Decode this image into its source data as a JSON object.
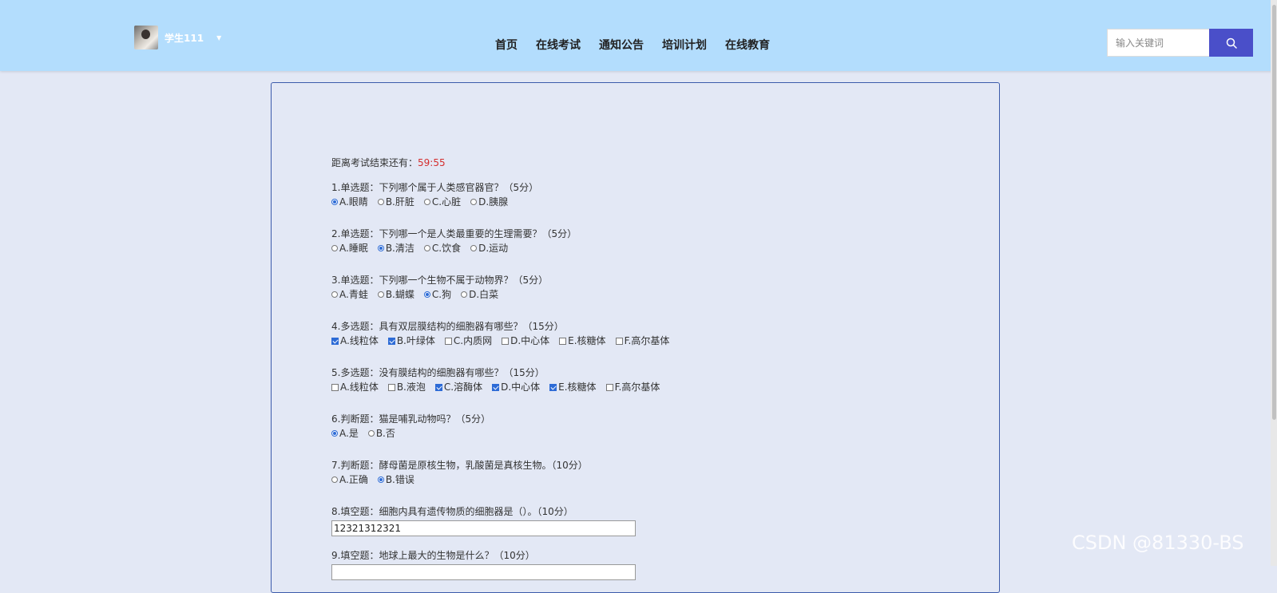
{
  "header": {
    "user": {
      "name": "学生111"
    },
    "nav": [
      "首页",
      "在线考试",
      "通知公告",
      "培训计划",
      "在线教育"
    ],
    "search": {
      "placeholder": "输入关键词"
    }
  },
  "exam": {
    "timer_label": "距离考试结束还有：",
    "timer_value": "59:55",
    "questions": [
      {
        "title": "1.单选题：下列哪个属于人类感官器官？（5分）",
        "type": "radio",
        "options": [
          {
            "label": "A.眼睛",
            "checked": true
          },
          {
            "label": "B.肝脏",
            "checked": false
          },
          {
            "label": "C.心脏",
            "checked": false
          },
          {
            "label": "D.胰腺",
            "checked": false
          }
        ]
      },
      {
        "title": "2.单选题：下列哪一个是人类最重要的生理需要？（5分）",
        "type": "radio",
        "options": [
          {
            "label": "A.睡眠",
            "checked": false
          },
          {
            "label": "B.清洁",
            "checked": true
          },
          {
            "label": "C.饮食",
            "checked": false
          },
          {
            "label": "D.运动",
            "checked": false
          }
        ]
      },
      {
        "title": "3.单选题：下列哪一个生物不属于动物界？（5分）",
        "type": "radio",
        "options": [
          {
            "label": "A.青蛙",
            "checked": false
          },
          {
            "label": "B.蝴蝶",
            "checked": false
          },
          {
            "label": "C.狗",
            "checked": true
          },
          {
            "label": "D.白菜",
            "checked": false
          }
        ]
      },
      {
        "title": "4.多选题：具有双层膜结构的细胞器有哪些？（15分）",
        "type": "checkbox",
        "options": [
          {
            "label": "A.线粒体",
            "checked": true
          },
          {
            "label": "B.叶绿体",
            "checked": true
          },
          {
            "label": "C.内质网",
            "checked": false
          },
          {
            "label": "D.中心体",
            "checked": false
          },
          {
            "label": "E.核糖体",
            "checked": false
          },
          {
            "label": "F.高尔基体",
            "checked": false
          }
        ]
      },
      {
        "title": "5.多选题：没有膜结构的细胞器有哪些？（15分）",
        "type": "checkbox",
        "options": [
          {
            "label": "A.线粒体",
            "checked": false
          },
          {
            "label": "B.液泡",
            "checked": false
          },
          {
            "label": "C.溶酶体",
            "checked": true
          },
          {
            "label": "D.中心体",
            "checked": true
          },
          {
            "label": "E.核糖体",
            "checked": true
          },
          {
            "label": "F.高尔基体",
            "checked": false
          }
        ]
      },
      {
        "title": "6.判断题：猫是哺乳动物吗？（5分）",
        "type": "radio",
        "options": [
          {
            "label": "A.是",
            "checked": true
          },
          {
            "label": "B.否",
            "checked": false
          }
        ]
      },
      {
        "title": "7.判断题：酵母菌是原核生物，乳酸菌是真核生物。（10分）",
        "type": "radio",
        "options": [
          {
            "label": "A.正确",
            "checked": false
          },
          {
            "label": "B.错误",
            "checked": true
          }
        ]
      },
      {
        "title": "8.填空题：细胞内具有遗传物质的细胞器是（）。（10分）",
        "type": "fill",
        "value": "12321312321"
      },
      {
        "title": "9.填空题：地球上最大的生物是什么？（10分）",
        "type": "fill",
        "value": ""
      }
    ]
  },
  "watermark": "CSDN @81330-BS"
}
